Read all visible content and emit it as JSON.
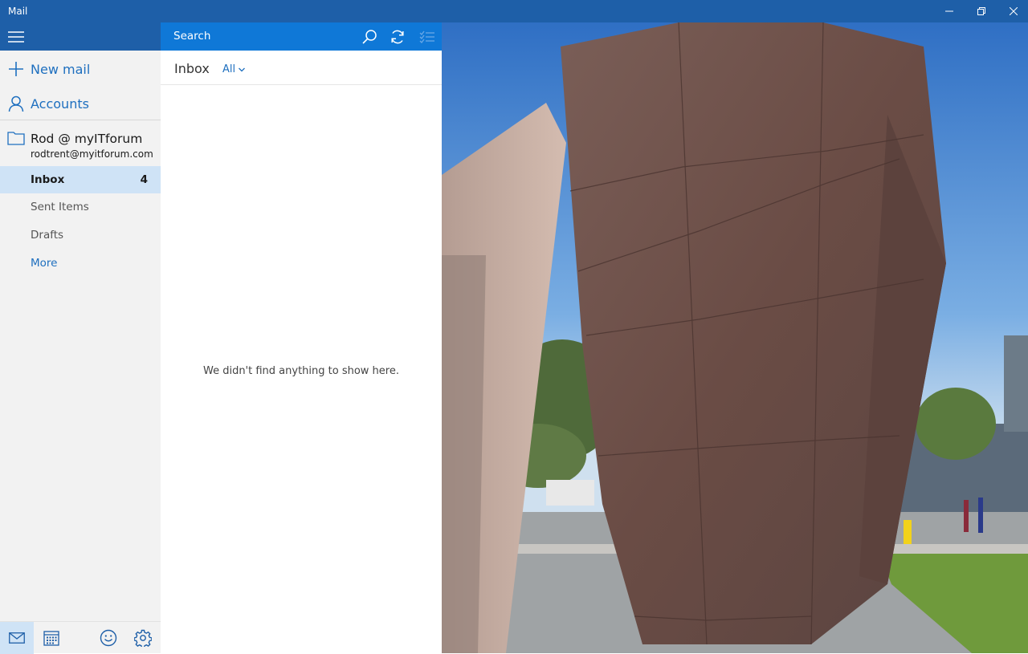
{
  "window": {
    "title": "Mail"
  },
  "nav": {
    "new_mail": "New mail",
    "accounts": "Accounts",
    "account": {
      "name": "Rod @ myITforum",
      "email": "rodtrent@myitforum.com"
    },
    "folders": [
      {
        "label": "Inbox",
        "count": "4",
        "active": true
      },
      {
        "label": "Sent Items"
      },
      {
        "label": "Drafts"
      },
      {
        "label": "More"
      }
    ],
    "bottom_icons": [
      "mail-icon",
      "calendar-icon",
      "feedback-smiley-icon",
      "settings-gear-icon"
    ]
  },
  "list": {
    "search_placeholder": "Search",
    "folder_title": "Inbox",
    "filter_label": "All",
    "empty_message": "We didn't find anything to show here."
  },
  "colors": {
    "titlebar": "#1e5fa8",
    "search_bar": "#0f78d7",
    "nav_bg": "#f2f2f2",
    "selected_folder": "#cfe3f6",
    "accent_text": "#1e6fbf"
  }
}
